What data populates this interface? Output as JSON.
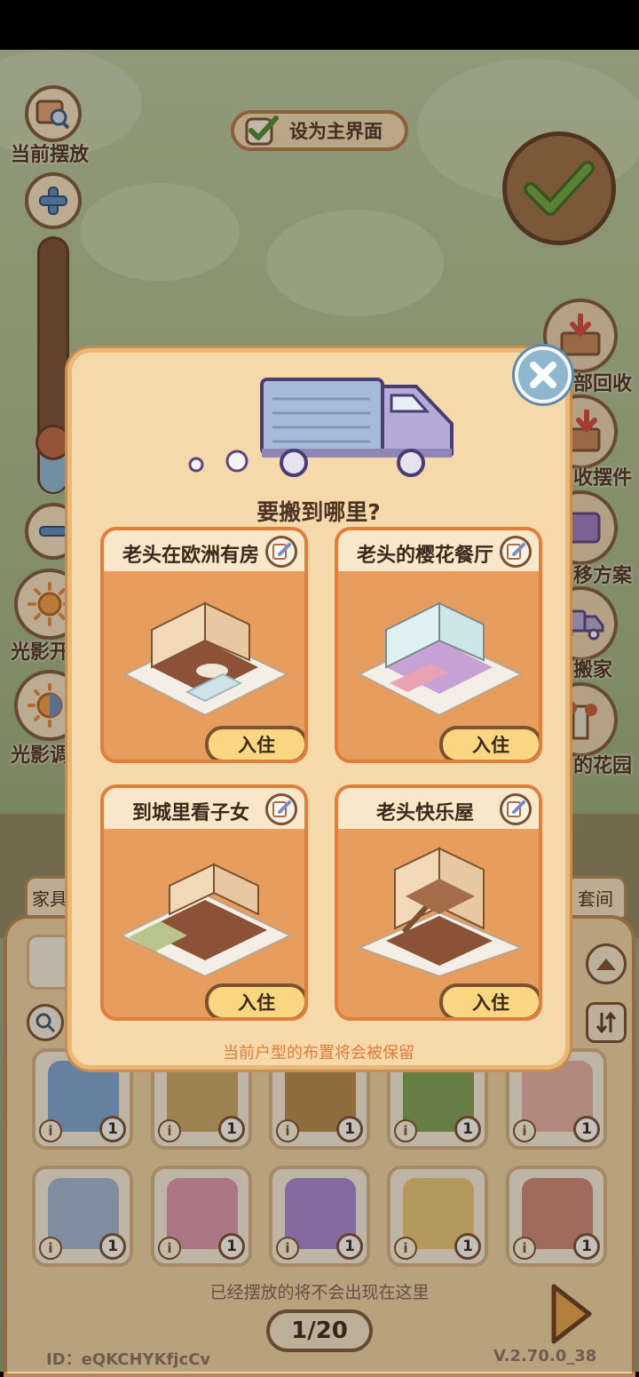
{
  "scene": {
    "current_placement_label": "当前摆放",
    "set_main_label": "设为主界面",
    "light_toggle_label": "光影开",
    "light_adjust_label": "光影调",
    "right_menu": [
      {
        "label": "部回收",
        "icon": "recycle-box-icon"
      },
      {
        "label": "收摆件",
        "icon": "collect-box-icon"
      },
      {
        "label": "移方案",
        "icon": "plan-icon"
      },
      {
        "label": "搬家",
        "icon": "truck-icon"
      },
      {
        "label": "的花园",
        "icon": "garden-icon"
      }
    ]
  },
  "bottom_panel": {
    "tab_left": "家具",
    "tab_right": "套间",
    "items_row1": [
      {
        "name": "desk-with-scale",
        "count": "1",
        "color": "#7fa7d4"
      },
      {
        "name": "bird-nest-decor",
        "count": "1",
        "color": "#c9a869"
      },
      {
        "name": "fruit-basket",
        "count": "1",
        "color": "#b98d4e"
      },
      {
        "name": "green-plant-decor",
        "count": "1",
        "color": "#7ea356"
      },
      {
        "name": "cake-stand",
        "count": "1",
        "color": "#e6b2a5"
      }
    ],
    "items_row2": [
      {
        "name": "robot-lamp",
        "count": "1",
        "color": "#a0b9d6"
      },
      {
        "name": "pink-fairy-doll",
        "count": "1",
        "color": "#e09ab0"
      },
      {
        "name": "purple-fairy-doll",
        "count": "1",
        "color": "#a88ad4"
      },
      {
        "name": "yellow-bathtub",
        "count": "1",
        "color": "#e9c978"
      },
      {
        "name": "gift-box",
        "count": "1",
        "color": "#cf8a7a"
      }
    ],
    "hint": "已经摆放的将不会出现在这里",
    "page": "1/20",
    "user_id": "ID：eQKCHYKfjcCv",
    "version": "V.2.70.0_38"
  },
  "modal": {
    "title": "要搬到哪里?",
    "note": "当前户型的布置将会被保留",
    "houses": [
      {
        "name": "老头在欧洲有房",
        "button": "入住"
      },
      {
        "name": "老头的樱花餐厅",
        "button": "入住"
      },
      {
        "name": "到城里看子女",
        "button": "入住"
      },
      {
        "name": "老头快乐屋",
        "button": "入住"
      }
    ]
  },
  "colors": {
    "panel": "#f6d9ab",
    "card": "#e69d5e",
    "accent_orange": "#e07b3c",
    "brown": "#7b5230",
    "truck": "#b4abd9"
  }
}
